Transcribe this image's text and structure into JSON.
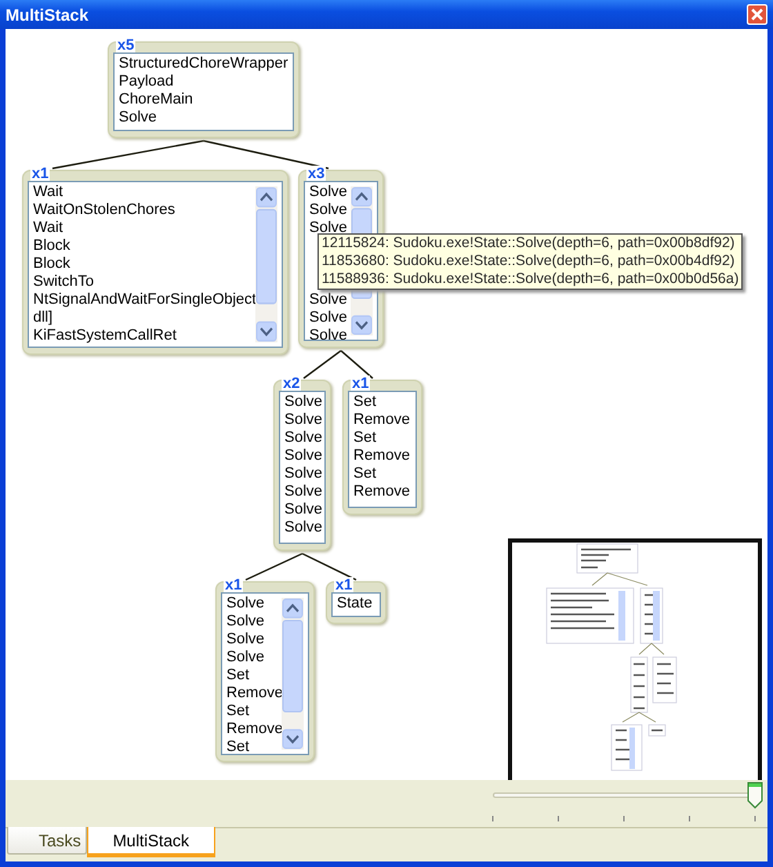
{
  "window": {
    "title": "MultiStack"
  },
  "stack_tree": {
    "count": "x5",
    "frames": [
      "StructuredChoreWrapper",
      "Payload",
      "ChoreMain",
      "Solve"
    ],
    "scrollable": false,
    "children": [
      {
        "count": "x1",
        "frames": [
          "Wait",
          "WaitOnStolenChores",
          "Wait",
          "Block",
          "Block",
          "SwitchTo",
          "NtSignalAndWaitForSingleObject",
          "dll]",
          "KiFastSystemCallRet"
        ],
        "scrollable": true
      },
      {
        "count": "x3",
        "frames": [
          "Solve",
          "Solve",
          "Solve",
          "Solve",
          "Solve",
          "Solve"
        ],
        "scrollable": true,
        "children": [
          {
            "count": "x2",
            "frames": [
              "Solve",
              "Solve",
              "Solve",
              "Solve",
              "Solve",
              "Solve",
              "Solve",
              "Solve"
            ],
            "scrollable": false,
            "children": [
              {
                "count": "x1",
                "frames": [
                  "Solve",
                  "Solve",
                  "Solve",
                  "Solve",
                  "Set",
                  "Remove",
                  "Set",
                  "Remove",
                  "Set"
                ],
                "scrollable": true
              },
              {
                "count": "x1",
                "frames": [
                  "State"
                ],
                "scrollable": false
              }
            ]
          },
          {
            "count": "x1",
            "frames": [
              "Set",
              "Remove",
              "Set",
              "Remove",
              "Set",
              "Remove"
            ],
            "scrollable": false
          }
        ]
      }
    ]
  },
  "tooltip": {
    "lines": [
      "12115824: Sudoku.exe!State::Solve(depth=6, path=0x00b8df92)",
      "11853680: Sudoku.exe!State::Solve(depth=6, path=0x00b4df92)",
      "11588936: Sudoku.exe!State::Solve(depth=6, path=0x00b0d56a)"
    ]
  },
  "zoom_slider": {
    "level": 1
  },
  "tabs": [
    {
      "label": "Tasks",
      "selected": false
    },
    {
      "label": "MultiStack",
      "selected": true
    }
  ]
}
